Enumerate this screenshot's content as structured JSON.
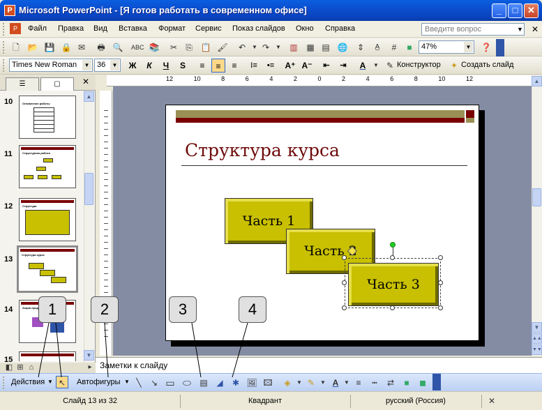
{
  "window": {
    "title": "Microsoft PowerPoint - [Я готов работать в современном офисе]",
    "app_icon": "P"
  },
  "menu": {
    "items": [
      "Файл",
      "Правка",
      "Вид",
      "Вставка",
      "Формат",
      "Сервис",
      "Показ слайдов",
      "Окно",
      "Справка"
    ],
    "ask_placeholder": "Введите вопрос"
  },
  "standard_toolbar": {
    "zoom": "47%"
  },
  "format_toolbar": {
    "font": "Times New Roman",
    "size": "36",
    "bold": "Ж",
    "italic": "К",
    "underline": "Ч",
    "shadow": "S",
    "designer": "Конструктор",
    "new_slide": "Создать слайд"
  },
  "ruler": {
    "h_labels": [
      "12",
      "10",
      "8",
      "6",
      "4",
      "2",
      "0",
      "2",
      "4",
      "6",
      "8",
      "10",
      "12"
    ]
  },
  "slides_panel": {
    "slides": [
      {
        "num": "10",
        "title": "Оглавление работы"
      },
      {
        "num": "11",
        "title": "Структурная работа"
      },
      {
        "num": "12",
        "title": "Структура"
      },
      {
        "num": "13",
        "title": "Структура курса"
      },
      {
        "num": "14",
        "title": "Акция продажи"
      },
      {
        "num": "15",
        "title": ""
      }
    ]
  },
  "slide": {
    "title": "Структура курса",
    "parts": [
      "Часть 1",
      "Часть 2",
      "Часть 3"
    ]
  },
  "notes": {
    "placeholder": "Заметки к слайду"
  },
  "drawing_toolbar": {
    "actions": "Действия",
    "autoshapes": "Автофигуры"
  },
  "status": {
    "slide": "Слайд 13 из 32",
    "design": "Квадрант",
    "language": "русский (Россия)"
  },
  "callouts": [
    "1",
    "2",
    "3",
    "4"
  ]
}
